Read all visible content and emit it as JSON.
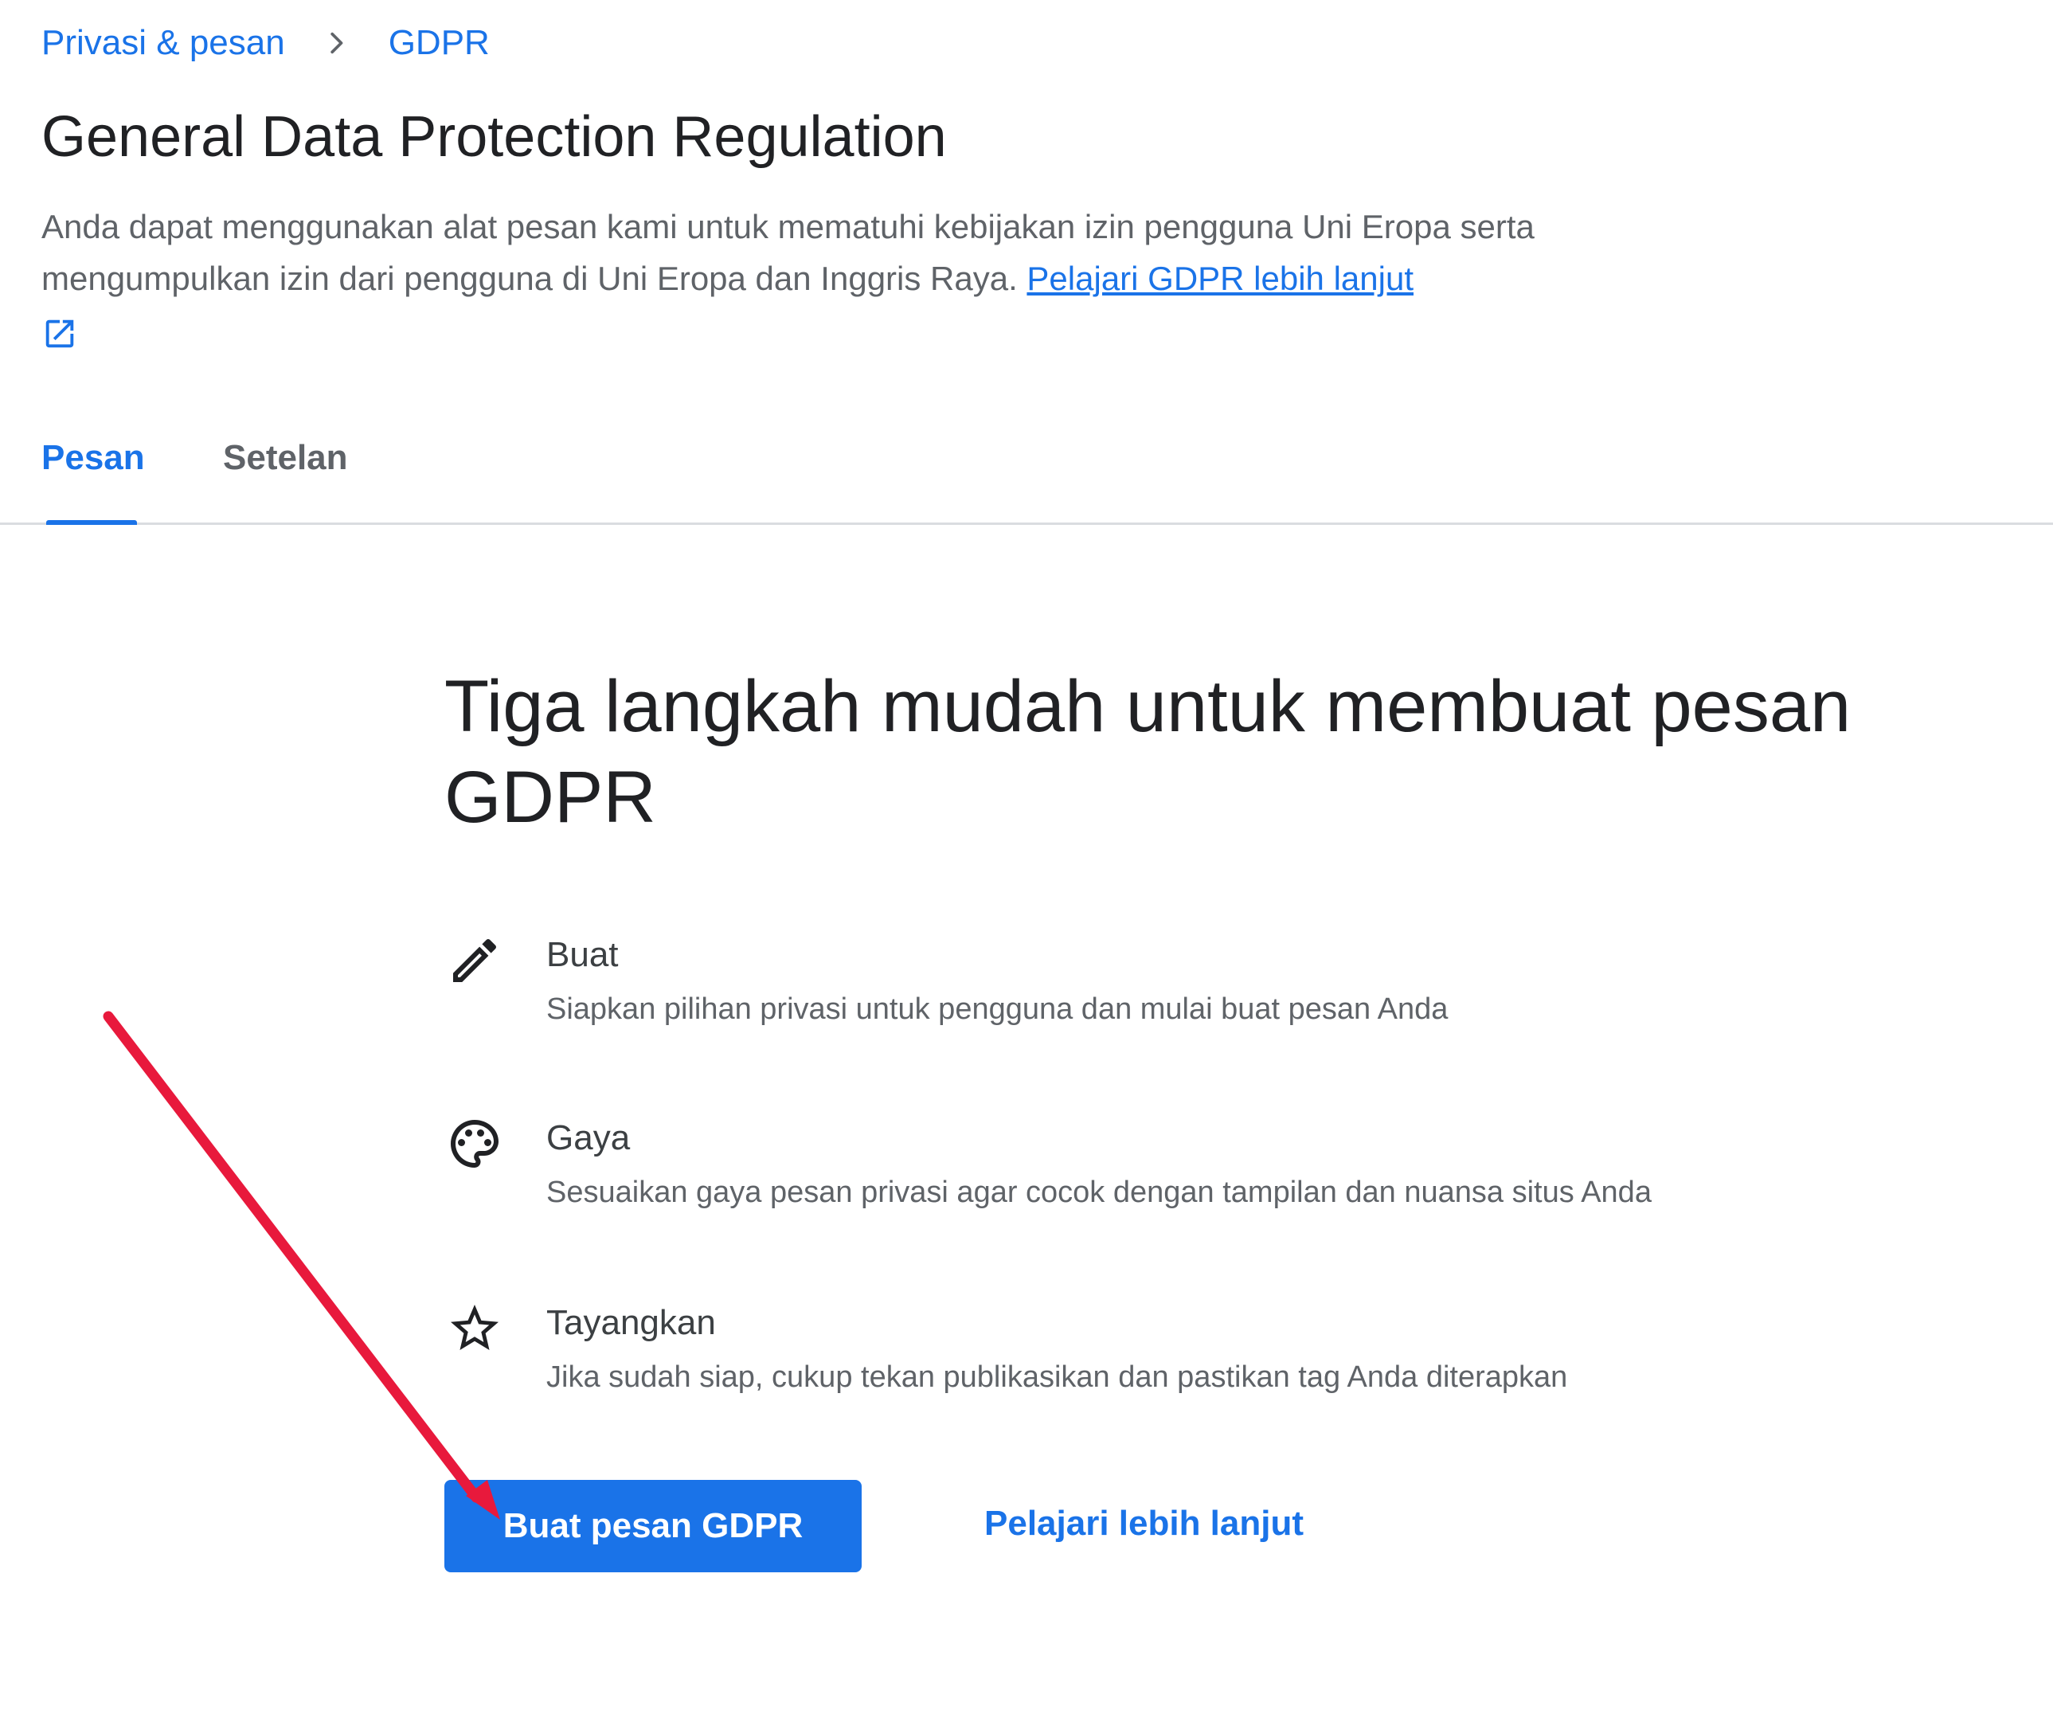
{
  "breadcrumb": {
    "items": [
      {
        "label": "Privasi & pesan"
      },
      {
        "label": "GDPR"
      }
    ]
  },
  "header": {
    "title": "General Data Protection Regulation",
    "description": "Anda dapat menggunakan alat pesan kami untuk mematuhi kebijakan izin pengguna Uni Eropa serta mengumpulkan izin dari pengguna di Uni Eropa dan Inggris Raya. ",
    "learn_link": "Pelajari GDPR lebih lanjut"
  },
  "tabs": [
    {
      "label": "Pesan",
      "active": true
    },
    {
      "label": "Setelan",
      "active": false
    }
  ],
  "main": {
    "heading": "Tiga langkah mudah untuk membuat pesan GDPR",
    "steps": [
      {
        "icon": "pencil-icon",
        "title": "Buat",
        "description": "Siapkan pilihan privasi untuk pengguna dan mulai buat pesan Anda"
      },
      {
        "icon": "palette-icon",
        "title": "Gaya",
        "description": "Sesuaikan gaya pesan privasi agar cocok dengan tampilan dan nuansa situs Anda"
      },
      {
        "icon": "star-icon",
        "title": "Tayangkan",
        "description": "Jika sudah siap, cukup tekan publikasikan dan pastikan tag Anda diterapkan"
      }
    ],
    "primary_button": "Buat pesan GDPR",
    "secondary_link": "Pelajari lebih lanjut"
  },
  "colors": {
    "accent": "#1a73e8",
    "annotation_arrow": "#e8193c"
  }
}
